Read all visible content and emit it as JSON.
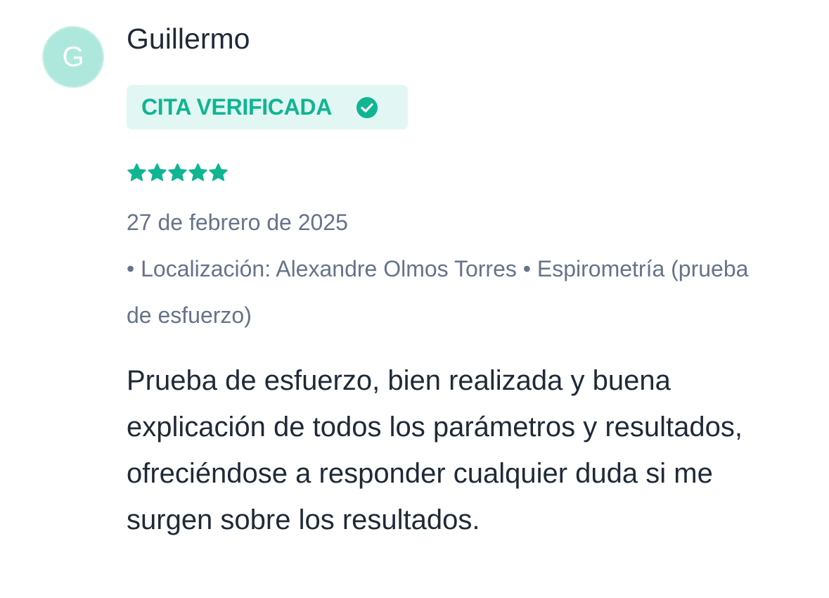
{
  "review": {
    "avatar_initial": "G",
    "author": "Guillermo",
    "badge_label": "CITA VERIFICADA",
    "rating": 5,
    "rating_max": 5,
    "date": "27 de febrero de 2025",
    "meta_line": "• Localización: Alexandre Olmos Torres • Espirometría (prueba de esfuerzo)",
    "text": "Prueba de esfuerzo, bien realizada y buena explicación de todos los parámetros y resultados, ofreciéndose a responder cualquier duda si me surgen sobre los resultados."
  },
  "colors": {
    "accent": "#10b592",
    "avatar_bg": "#aee8dc",
    "badge_bg": "#e2f7f3",
    "meta_text": "#66738a",
    "body_text": "#1f2a37"
  },
  "icons": {
    "badge": "check-circle-icon",
    "rating": "star-icon"
  }
}
